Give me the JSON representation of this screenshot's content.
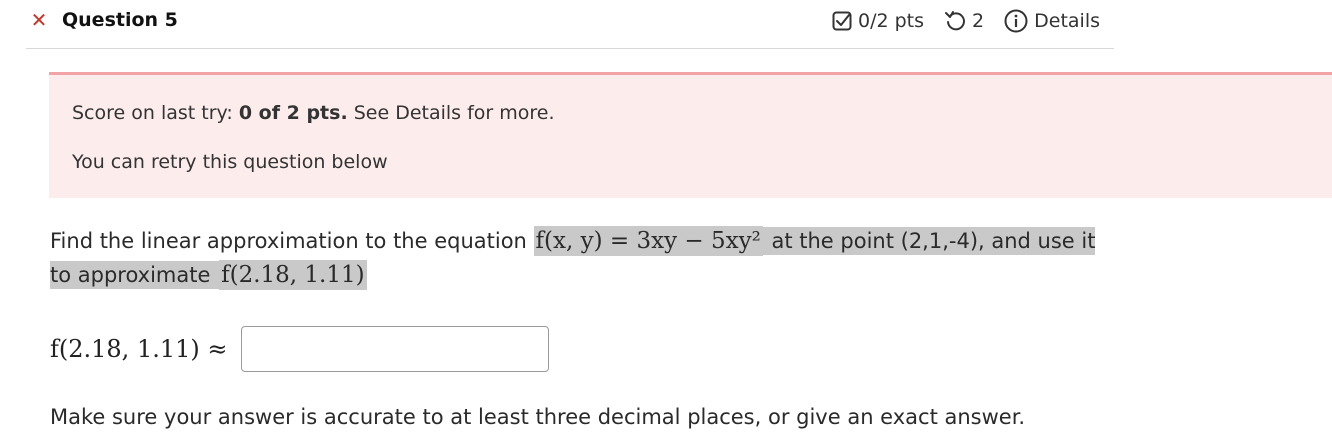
{
  "header": {
    "close_symbol": "✕",
    "title": "Question 5",
    "score": "0/2 pts",
    "retries": "2",
    "details": "Details"
  },
  "banner": {
    "score_prefix": "Score on last try: ",
    "score_value": "0 of 2 pts.",
    "score_suffix": " See Details for more.",
    "retry_text": "You can retry this question below"
  },
  "question": {
    "part1": "Find the linear approximation to the equation ",
    "function": "f(x, y) = 3xy − 5xy²",
    "part2": " at the point (2,1,-4), and use it to approximate ",
    "target": "f(2.18, 1.11)"
  },
  "answer": {
    "label": "f(2.18, 1.11) ≈",
    "value": "",
    "placeholder": ""
  },
  "note": "Make sure your answer is accurate to at least three decimal places, or give an exact answer.",
  "colors": {
    "close": "#c0392b",
    "banner_bg": "#fdecec",
    "banner_border": "#f2a3a8",
    "highlight": "#c9c9c9"
  },
  "icons": [
    "close-icon",
    "checkbox-icon",
    "retry-icon",
    "info-icon"
  ]
}
